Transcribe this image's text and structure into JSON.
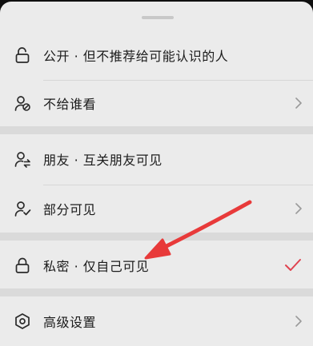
{
  "visibility_sheet": {
    "options": [
      {
        "label": "公开 · 但不推荐给可能认识的人",
        "icon": "unlock-icon"
      },
      {
        "label": "不给谁看",
        "icon": "user-block-icon"
      },
      {
        "label": "朋友 · 互关朋友可见",
        "icon": "user-swap-icon"
      },
      {
        "label": "部分可见",
        "icon": "user-check-icon"
      },
      {
        "label": "私密 · 仅自己可见",
        "icon": "lock-icon",
        "selected": true
      },
      {
        "label": "高级设置",
        "icon": "hexagon-settings-icon"
      }
    ],
    "colors": {
      "sheet_bg": "#ebebeb",
      "separator": "#dadada",
      "text": "#1b1b1b",
      "check": "#e0424f",
      "annotation_arrow": "#e83a3a"
    }
  }
}
